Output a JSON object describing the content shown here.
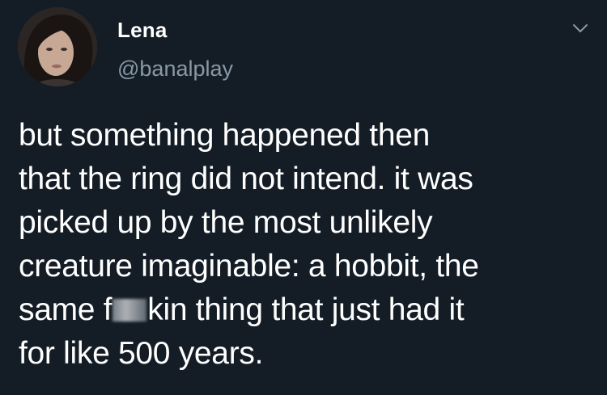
{
  "tweet": {
    "author": {
      "display_name": "Lena",
      "handle": "@banalplay",
      "avatar_icon": "profile-photo-avatar"
    },
    "menu_icon": "chevron-down-icon",
    "text_lines": [
      "but something happened then",
      "that the ring did not intend. it was",
      "picked up by the most unlikely",
      "creature imaginable: a hobbit, the"
    ],
    "line5_before": "same f",
    "line5_after": "kin thing that just had it",
    "line6": "for like 500 years."
  },
  "colors": {
    "background": "#141d26",
    "text": "#ffffff",
    "handle": "#8899a6",
    "chevron": "#8899a6"
  }
}
